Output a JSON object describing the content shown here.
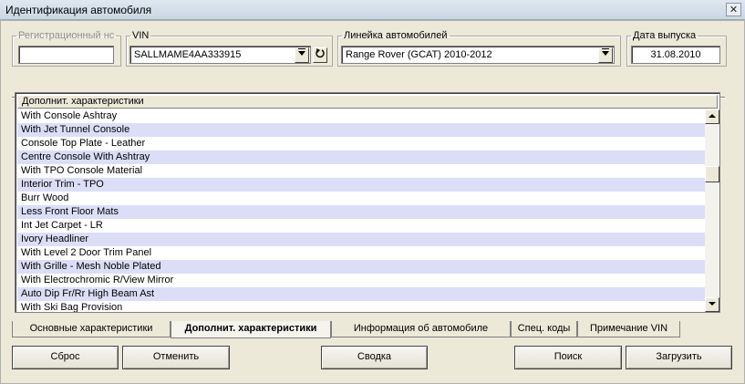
{
  "window": {
    "title": "Идентификация автомобиля",
    "close_glyph": "✕"
  },
  "fields": {
    "reg": {
      "label": "Регистрационный нс",
      "value": ""
    },
    "vin": {
      "label": "VIN",
      "value": "SALLMAME4AA333915"
    },
    "line": {
      "label": "Линейка автомобилей",
      "value": "Range Rover (GCAT) 2010-2012"
    },
    "date": {
      "label": "Дата выпуска",
      "value": "31.08.2010"
    }
  },
  "list": {
    "header": "Дополнит. характеристики",
    "items": [
      "With Console Ashtray",
      "With Jet Tunnel Console",
      "Console Top Plate - Leather",
      "Centre Console With Ashtray",
      "With TPO Console Material",
      "Interior Trim - TPO",
      "Burr Wood",
      "Less Front Floor Mats",
      "Int Jet Carpet - LR",
      "Ivory Headliner",
      "With Level 2 Door Trim Panel",
      "With Grille - Mesh Noble Plated",
      "With Electrochromic R/View Mirror",
      "Auto Dip Fr/Rr High Beam Ast",
      "With Ski Bag Provision"
    ]
  },
  "tabs": [
    "Основные характеристики",
    "Дополнит. характеристики",
    "Информация об автомобиле",
    "Спец. коды",
    "Примечание VIN"
  ],
  "active_tab": 1,
  "buttons": {
    "reset": "Сброс",
    "cancel": "Отменить",
    "summary": "Сводка",
    "search": "Поиск",
    "load": "Загрузить"
  },
  "icons": {
    "dropdown": "dropdown-arrow-icon",
    "refresh": "refresh-icon",
    "scroll_up": "scroll-up-icon",
    "scroll_down": "scroll-down-icon"
  },
  "colors": {
    "row_alt": "#dcdef8",
    "face": "#ece9d8"
  }
}
